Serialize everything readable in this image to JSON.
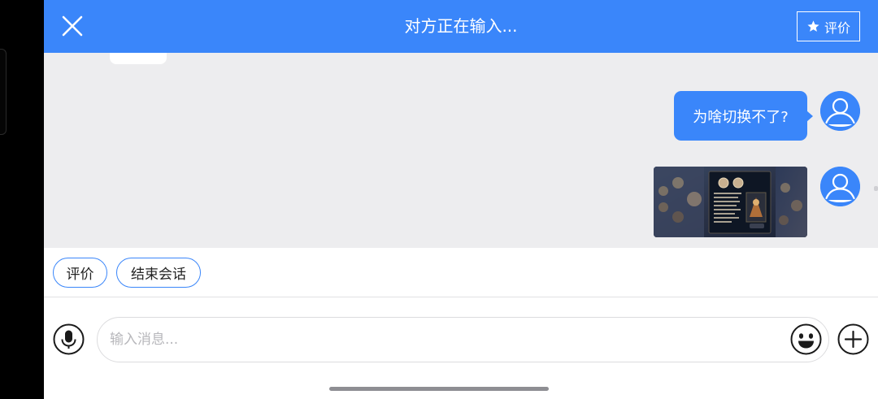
{
  "header": {
    "title": "对方正在输入...",
    "close_icon": "close-icon",
    "rate_icon": "star-icon",
    "rate_label": "评价"
  },
  "chat": {
    "messages": [
      {
        "side": "right",
        "type": "text",
        "text": "为啥切换不了?"
      },
      {
        "side": "right",
        "type": "image",
        "content": "game-screenshot"
      }
    ]
  },
  "quick_actions": [
    {
      "label": "评价"
    },
    {
      "label": "结束会话"
    }
  ],
  "composer": {
    "voice_icon": "microphone-icon",
    "placeholder": "输入消息...",
    "emoji_icon": "emoji-icon",
    "add_icon": "plus-circle-icon"
  },
  "colors": {
    "accent": "#3a86fa",
    "chat_background": "#ededef"
  }
}
